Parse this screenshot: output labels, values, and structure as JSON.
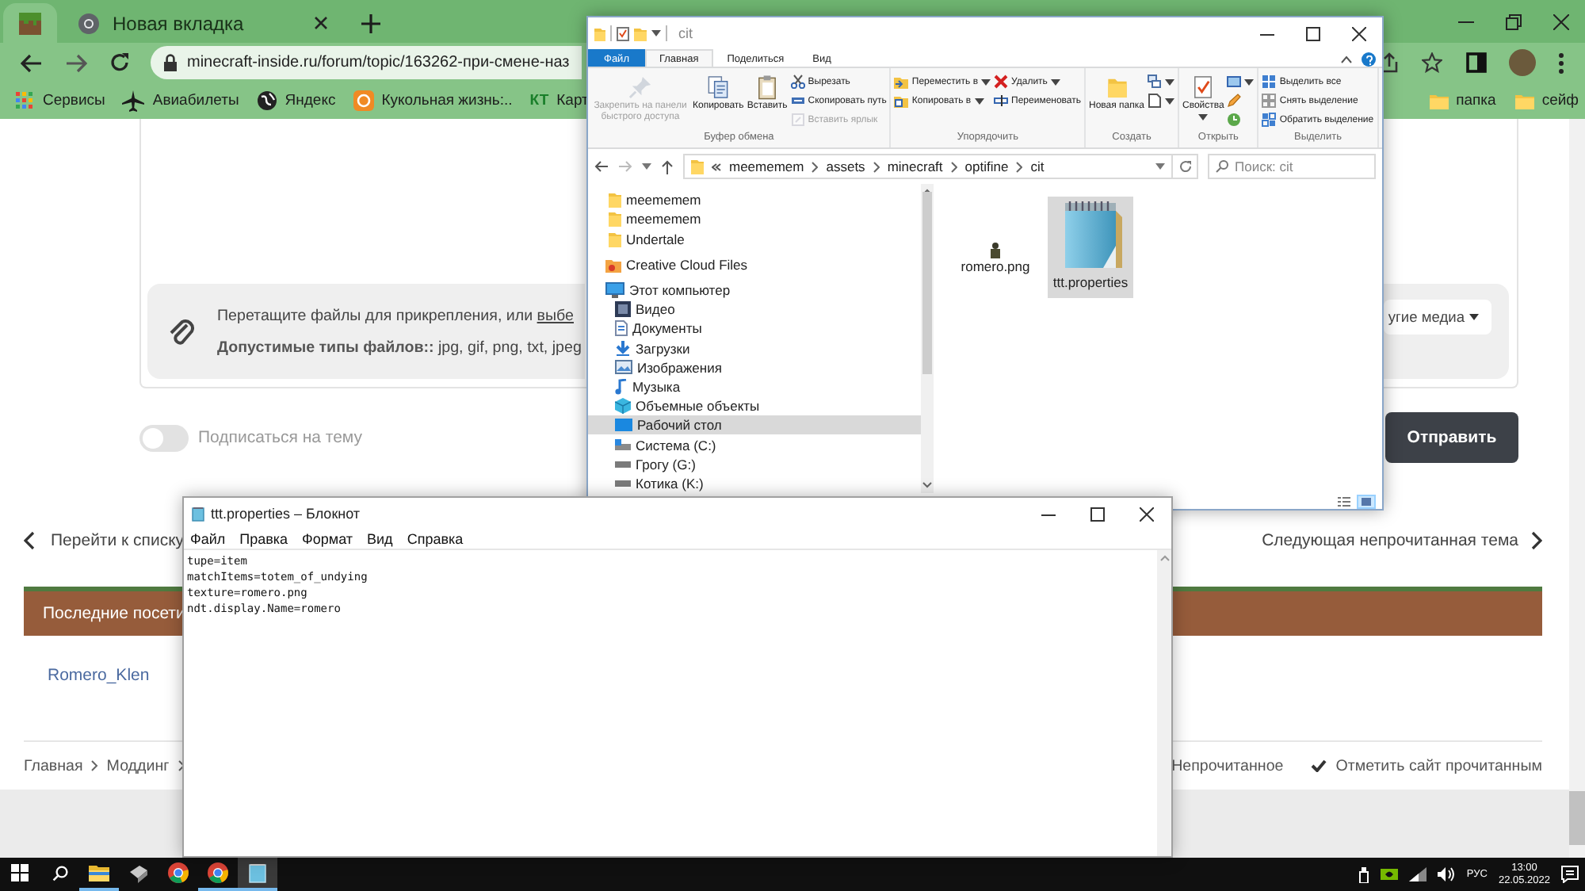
{
  "browser": {
    "tabs": [
      {
        "kind": "pinned",
        "selected": true
      },
      {
        "kind": "page",
        "title": "Новая вкладка",
        "selected": false
      }
    ],
    "address": {
      "url": "minecraft-inside.ru/forum/topic/163262-при-смене-наз"
    },
    "bookmarks": [
      {
        "kind": "apps",
        "label": "Сервисы"
      },
      {
        "kind": "plane",
        "label": "Авиабилеты"
      },
      {
        "kind": "globe",
        "label": "Яндекс"
      },
      {
        "kind": "site",
        "label": "Кукольная жизнь:.."
      },
      {
        "kind": "badge",
        "badge": "КТ",
        "label": "Карт"
      }
    ],
    "bookmark_folders": [
      {
        "label": "папка"
      },
      {
        "label": "сейф"
      }
    ]
  },
  "forum": {
    "attach": {
      "hint": "Перетащите файлы для прикрепления, или ",
      "link": "выбе",
      "types": "**Допустимые типы файлов::** jpg, gif, png, txt, jpeg",
      "media_button": "угие медиа"
    },
    "subscribe": {
      "label": "Подписаться на тему",
      "checked": false
    },
    "submit": "Отправить",
    "prev": "Перейти к списку",
    "next": "Следующая непрочитанная тема",
    "visitors_title": "Последние посети",
    "visitors": [
      "Romero_Klen"
    ],
    "breadcrumb": [
      "Главная",
      "Моддинг"
    ],
    "footer_links": [
      {
        "kind": "plain",
        "label": "Непрочитанное"
      },
      {
        "kind": "check",
        "label": "Отметить сайт прочитанным"
      }
    ]
  },
  "explorer": {
    "title": "cit",
    "ribbon_tabs": [
      {
        "kind": "file",
        "label": "Файл",
        "selected": false
      },
      {
        "kind": "tab",
        "label": "Главная",
        "selected": true
      },
      {
        "kind": "tab",
        "label": "Поделиться",
        "selected": false
      },
      {
        "kind": "tab",
        "label": "Вид",
        "selected": false
      }
    ],
    "ribbon_groups": [
      {
        "label": "Буфер обмена",
        "columns": [
          {
            "kind": "large",
            "items": [
              {
                "kind": "pin",
                "label": "Закрепить на панели быстрого доступа",
                "disabled": true,
                "dropdown": false
              }
            ]
          },
          {
            "kind": "large",
            "items": [
              {
                "kind": "copy",
                "label": "Копировать",
                "disabled": false,
                "dropdown": false
              }
            ]
          },
          {
            "kind": "large",
            "items": [
              {
                "kind": "paste",
                "label": "Вставить",
                "disabled": false,
                "dropdown": false
              }
            ]
          },
          {
            "kind": "small",
            "items": [
              {
                "kind": "cut",
                "label": "Вырезать",
                "disabled": false,
                "dropdown": false
              },
              {
                "kind": "copy-path",
                "label": "Скопировать путь",
                "disabled": false,
                "dropdown": false
              },
              {
                "kind": "shortcut",
                "label": "Вставить ярлык",
                "disabled": true,
                "dropdown": false
              }
            ]
          }
        ]
      },
      {
        "label": "Упорядочить",
        "columns": [
          {
            "kind": "small",
            "items": [
              {
                "kind": "move",
                "label": "Переместить в",
                "disabled": false,
                "dropdown": true
              },
              {
                "kind": "copy-to",
                "label": "Копировать в",
                "disabled": false,
                "dropdown": true
              }
            ]
          },
          {
            "kind": "small",
            "items": [
              {
                "kind": "delete",
                "label": "Удалить",
                "disabled": false,
                "dropdown": true
              },
              {
                "kind": "rename",
                "label": "Переименовать",
                "disabled": false,
                "dropdown": false
              }
            ]
          }
        ]
      },
      {
        "label": "Создать",
        "columns": [
          {
            "kind": "large",
            "items": [
              {
                "kind": "new-folder",
                "label": "Новая папка",
                "disabled": false,
                "dropdown": false
              }
            ]
          },
          {
            "kind": "small",
            "items": [
              {
                "kind": "new-item",
                "disabled": false,
                "dropdown": true
              },
              {
                "kind": "easy-access",
                "disabled": false,
                "dropdown": true
              }
            ]
          }
        ]
      },
      {
        "label": "Открыть",
        "columns": [
          {
            "kind": "large",
            "items": [
              {
                "kind": "properties",
                "label": "Свойства",
                "disabled": false,
                "dropdown": true
              }
            ]
          },
          {
            "kind": "small",
            "items": [
              {
                "kind": "open",
                "disabled": false,
                "dropdown": true
              },
              {
                "kind": "edit",
                "disabled": false,
                "dropdown": false
              },
              {
                "kind": "history",
                "disabled": false,
                "dropdown": false
              }
            ]
          }
        ]
      },
      {
        "label": "Выделить",
        "columns": [
          {
            "kind": "small",
            "items": [
              {
                "kind": "select-all",
                "label": "Выделить все",
                "disabled": false,
                "dropdown": false
              },
              {
                "kind": "select-none",
                "label": "Снять выделение",
                "disabled": false,
                "dropdown": false
              },
              {
                "kind": "invert",
                "label": "Обратить выделение",
                "disabled": false,
                "dropdown": false
              }
            ]
          }
        ]
      }
    ],
    "path": [
      "meememem",
      "assets",
      "minecraft",
      "optifine",
      "cit"
    ],
    "search": {
      "placeholder": "Поиск: cit"
    },
    "nav": [
      {
        "kind": "folder",
        "label": "meememem",
        "selected": false
      },
      {
        "kind": "folder",
        "label": "meememem",
        "selected": false
      },
      {
        "kind": "folder",
        "label": "Undertale",
        "selected": false
      },
      {
        "kind": "cloud",
        "label": "Creative Cloud Files",
        "selected": false
      },
      {
        "kind": "pc",
        "label": "Этот компьютер",
        "selected": false,
        "children": [
          {
            "kind": "video",
            "label": "Видео",
            "selected": false
          },
          {
            "kind": "docs",
            "label": "Документы",
            "selected": false
          },
          {
            "kind": "downloads",
            "label": "Загрузки",
            "selected": false
          },
          {
            "kind": "images",
            "label": "Изображения",
            "selected": false
          },
          {
            "kind": "music",
            "label": "Музыка",
            "selected": false
          },
          {
            "kind": "objects",
            "label": "Объемные объекты",
            "selected": false
          },
          {
            "kind": "desktop",
            "label": "Рабочий стол",
            "selected": true
          },
          {
            "kind": "system",
            "label": "Система (C:)",
            "selected": false
          },
          {
            "kind": "drive",
            "label": "Грогу (G:)",
            "selected": false
          },
          {
            "kind": "drive",
            "label": "Котика  (K:)",
            "selected": false
          }
        ]
      }
    ],
    "files": [
      {
        "kind": "image",
        "name": "romero.png",
        "selected": false
      },
      {
        "kind": "text",
        "name": "ttt.properties",
        "selected": true
      }
    ],
    "views": [
      {
        "kind": "details",
        "selected": false
      },
      {
        "kind": "icons",
        "selected": true
      }
    ]
  },
  "notepad": {
    "title": "ttt.properties – Блокнот",
    "menu": [
      "Файл",
      "Правка",
      "Формат",
      "Вид",
      "Справка"
    ],
    "text": "tupe=item\nmatchItems=totem_of_undying\ntexture=romero.png\nndt.display.Name=romero"
  },
  "taskbar": {
    "apps": [
      {
        "kind": "explorer",
        "open": true,
        "focused": false
      },
      {
        "kind": "tool",
        "open": false,
        "focused": false
      },
      {
        "kind": "chrome",
        "open": false,
        "focused": false
      },
      {
        "kind": "chrome",
        "open": true,
        "focused": false
      },
      {
        "kind": "notepad",
        "open": true,
        "focused": true
      }
    ],
    "language": "РУС",
    "time": "13:00",
    "date": "22.05.2022"
  }
}
